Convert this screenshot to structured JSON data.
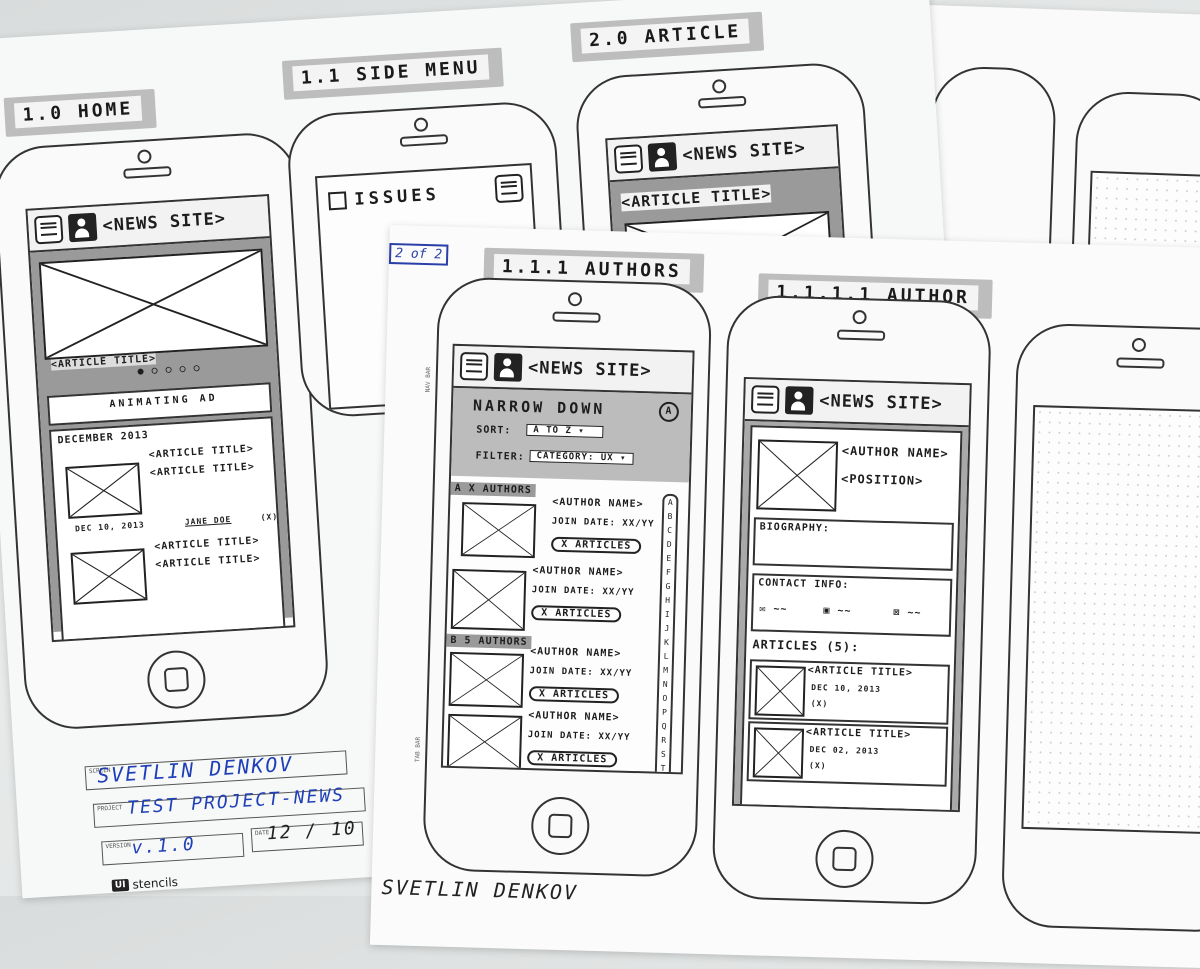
{
  "sheets": {
    "home": {
      "tab": "1.0 HOME",
      "nav_title": "<NEWS SITE>",
      "slide_title": "<ARTICLE TITLE>",
      "ad": "ANIMATING AD",
      "section": "DECEMBER 2013",
      "articles": [
        {
          "t1": "<ARTICLE TITLE>",
          "t2": "<ARTICLE TITLE>",
          "date": "DEC 10, 2013",
          "author": "JANE DOE",
          "count": "(X)"
        },
        {
          "t1": "<ARTICLE TITLE>",
          "t2": "<ARTICLE TITLE>"
        }
      ]
    },
    "side_menu": {
      "tab": "1.1 SIDE MENU",
      "item": "ISSUES"
    },
    "article": {
      "tab": "2.0 ARTICLE",
      "nav_title": "<NEWS SITE>",
      "title": "<ARTICLE TITLE>"
    },
    "authors": {
      "tab": "1.1.1 AUTHORS",
      "page_badge": "2 of 2",
      "nav_title": "<NEWS SITE>",
      "narrow": "NARROW DOWN",
      "sort_label": "SORT:",
      "sort_value": "A TO Z",
      "filter_label": "FILTER:",
      "filter_value": "CATEGORY: UX",
      "group_a": "A  X AUTHORS",
      "group_b": "B  5 AUTHORS",
      "rows": [
        {
          "name": "<AUTHOR NAME>",
          "date": "JOIN DATE: XX/YY",
          "articles": "X ARTICLES"
        },
        {
          "name": "<AUTHOR NAME>",
          "date": "JOIN DATE: XX/YY",
          "articles": "X ARTICLES"
        },
        {
          "name": "<AUTHOR NAME>",
          "date": "JOIN DATE: XX/YY",
          "articles": "X ARTICLES"
        },
        {
          "name": "<AUTHOR NAME>",
          "date": "JOIN DATE: XX/YY",
          "articles": "X ARTICLES"
        }
      ],
      "alphabet": [
        "A",
        "B",
        "C",
        "D",
        "E",
        "F",
        "G",
        "H",
        "I",
        "J",
        "K",
        "L",
        "M",
        "N",
        "O",
        "P",
        "Q",
        "R",
        "S",
        "T"
      ]
    },
    "author": {
      "tab": "1.1.1.1 AUTHOR",
      "nav_title": "<NEWS SITE>",
      "name": "<AUTHOR NAME>",
      "position": "<POSITION>",
      "bio": "BIOGRAPHY:",
      "contact": "CONTACT INFO:",
      "articles_head": "ARTICLES (5):",
      "articles": [
        {
          "title": "<ARTICLE TITLE>",
          "date": "DEC 10, 2013",
          "count": "(X)"
        },
        {
          "title": "<ARTICLE TITLE>",
          "date": "DEC 02, 2013",
          "count": "(X)"
        }
      ]
    }
  },
  "form": {
    "screen_cap": "SCREEN",
    "designer": "SVETLIN DENKOV",
    "project_cap": "PROJECT",
    "project": "TEST PROJECT-NEWS",
    "date_cap": "DATE",
    "date": "12 / 10",
    "version_cap": "VERSION",
    "version": "v.1.0",
    "brand": "stencils",
    "brand_mark": "UI",
    "bottom_name": "SVETLIN DENKOV"
  },
  "margin_labels": {
    "nav_bar": "NAV BAR",
    "tab_bar": "TAB BAR"
  }
}
